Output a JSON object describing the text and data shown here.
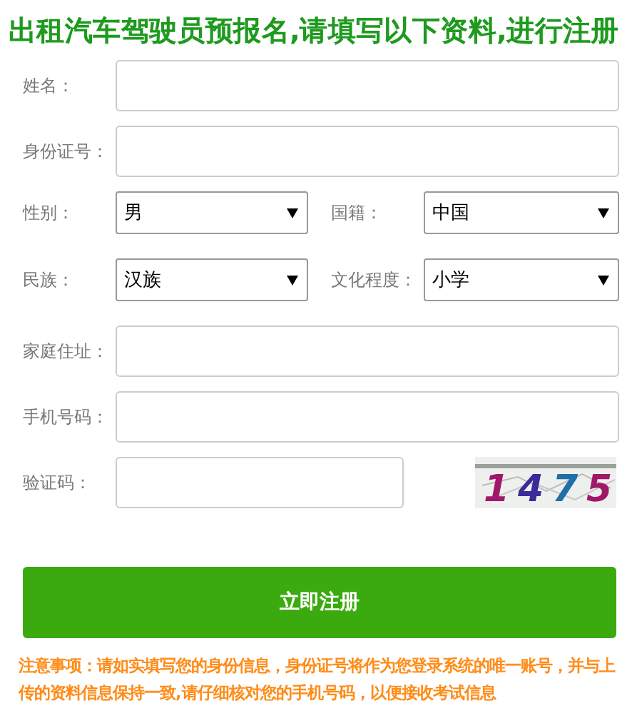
{
  "title": "出租汽车驾驶员预报名,请填写以下资料,进行注册",
  "rows": [
    {
      "fields": [
        {
          "label": "姓名：",
          "kind": "text"
        }
      ]
    },
    {
      "fields": [
        {
          "label": "身份证号：",
          "kind": "text"
        }
      ]
    },
    {
      "fields": [
        {
          "label": "性别：",
          "kind": "select",
          "value": "男"
        },
        {
          "label": "国籍：",
          "kind": "select",
          "value": "中国"
        }
      ]
    },
    {
      "fields": [
        {
          "label": "民族：",
          "kind": "select",
          "value": "汉族"
        },
        {
          "label": "文化程度：",
          "kind": "select",
          "value": "小学"
        }
      ]
    },
    {
      "fields": [
        {
          "label": "家庭住址：",
          "kind": "text"
        }
      ]
    },
    {
      "fields": [
        {
          "label": "手机号码：",
          "kind": "text"
        }
      ]
    },
    {
      "fields": [
        {
          "label": "验证码：",
          "kind": "captcha",
          "digits": [
            {
              "text": "1",
              "color": "#a0186a"
            },
            {
              "text": "4",
              "color": "#3a2a9a"
            },
            {
              "text": "7",
              "color": "#1f6fa8"
            },
            {
              "text": "5",
              "color": "#a0186a"
            }
          ]
        }
      ]
    }
  ],
  "submit": "立即注册",
  "notice": "注意事项：请如实填写您的身份信息，身份证号将作为您登录系统的唯一账号，并与上传的资料信息保持一致,请仔细核对您的手机号码，以便接收考试信息"
}
